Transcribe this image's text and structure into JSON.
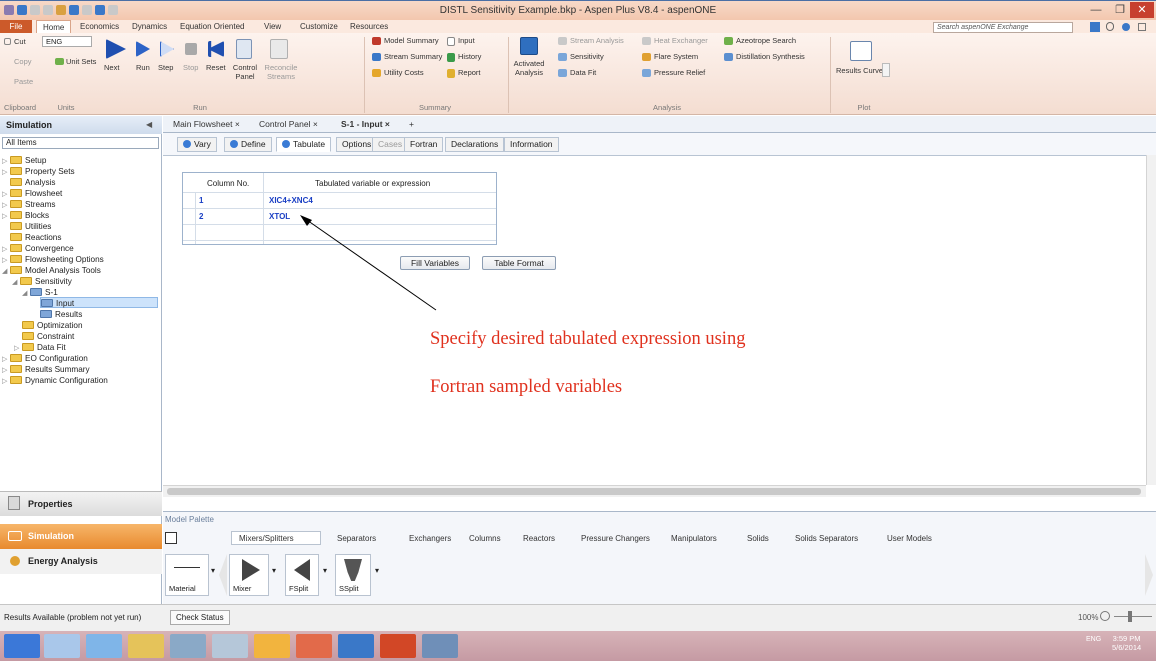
{
  "titlebar": {
    "title": "DISTL Sensitivity Example.bkp - Aspen Plus V8.4 - aspenONE"
  },
  "ribbon_tabs": {
    "file": "File",
    "home": "Home",
    "economics": "Economics",
    "dynamics": "Dynamics",
    "equation_oriented": "Equation Oriented",
    "view": "View",
    "customize": "Customize",
    "resources": "Resources"
  },
  "search": {
    "placeholder": "Search aspenONE Exchange"
  },
  "ribbon": {
    "clipboard": {
      "cut": "Cut",
      "copy": "Copy",
      "paste": "Paste",
      "group": "Clipboard"
    },
    "units": {
      "value": "ENG",
      "unit_sets": "Unit Sets",
      "group": "Units"
    },
    "run": {
      "next": "Next",
      "run": "Run",
      "step": "Step",
      "stop": "Stop",
      "reset": "Reset",
      "control_panel": "Control Panel",
      "reconcile_streams": "Reconcile Streams",
      "group": "Run"
    },
    "summary": {
      "model_summary": "Model Summary",
      "input": "Input",
      "stream_summary": "Stream Summary",
      "history": "History",
      "utility_costs": "Utility Costs",
      "report": "Report",
      "group": "Summary"
    },
    "analysis": {
      "activated_analysis": "Activated Analysis",
      "stream_analysis": "Stream Analysis",
      "sensitivity": "Sensitivity",
      "data_fit": "Data Fit",
      "heat_exchanger": "Heat Exchanger",
      "flare_system": "Flare System",
      "pressure_relief": "Pressure Relief",
      "azeotrope_search": "Azeotrope Search",
      "distillation_synthesis": "Distillation Synthesis",
      "group": "Analysis"
    },
    "plot": {
      "results_curve": "Results Curve",
      "group": "Plot"
    }
  },
  "left": {
    "header": "Simulation",
    "filter": "All Items",
    "tree": [
      "Setup",
      "Property Sets",
      "Analysis",
      "Flowsheet",
      "Streams",
      "Blocks",
      "Utilities",
      "Reactions",
      "Convergence",
      "Flowsheeting Options",
      "Model Analysis Tools",
      "Sensitivity",
      "S-1",
      "Input",
      "Results",
      "Optimization",
      "Constraint",
      "Data Fit",
      "EO Configuration",
      "Results Summary",
      "Dynamic Configuration"
    ],
    "nav": {
      "properties": "Properties",
      "simulation": "Simulation",
      "energy": "Energy Analysis"
    }
  },
  "doc_tabs": {
    "main_flowsheet": "Main Flowsheet",
    "control_panel": "Control Panel",
    "s1_input": "S-1 - Input",
    "add": "+"
  },
  "form_tabs": {
    "vary": "Vary",
    "define": "Define",
    "tabulate": "Tabulate",
    "options": "Options",
    "cases": "Cases",
    "fortran": "Fortran",
    "declarations": "Declarations",
    "information": "Information"
  },
  "grid": {
    "headers": [
      "Column No.",
      "Tabulated variable or expression"
    ],
    "rows": [
      {
        "no": "1",
        "expr": "XIC4+XNC4"
      },
      {
        "no": "2",
        "expr": "XTOL"
      }
    ]
  },
  "buttons": {
    "fill_variables": "Fill Variables",
    "table_format": "Table Format"
  },
  "annotation": {
    "line1": "Specify desired tabulated expression using",
    "line2": "Fortran sampled variables"
  },
  "palette": {
    "title": "Model Palette",
    "tabs": [
      "Mixers/Splitters",
      "Separators",
      "Exchangers",
      "Columns",
      "Reactors",
      "Pressure Changers",
      "Manipulators",
      "Solids",
      "Solids Separators",
      "User Models"
    ],
    "items": {
      "material": "Material",
      "mixer": "Mixer",
      "fsplit": "FSplit",
      "ssplit": "SSplit"
    }
  },
  "status": {
    "message": "Results Available (problem not yet run)",
    "check_status": "Check Status",
    "zoom": "100%"
  },
  "taskbar": {
    "time": "3:59 PM",
    "date": "5/6/2014",
    "lang": "ENG"
  }
}
